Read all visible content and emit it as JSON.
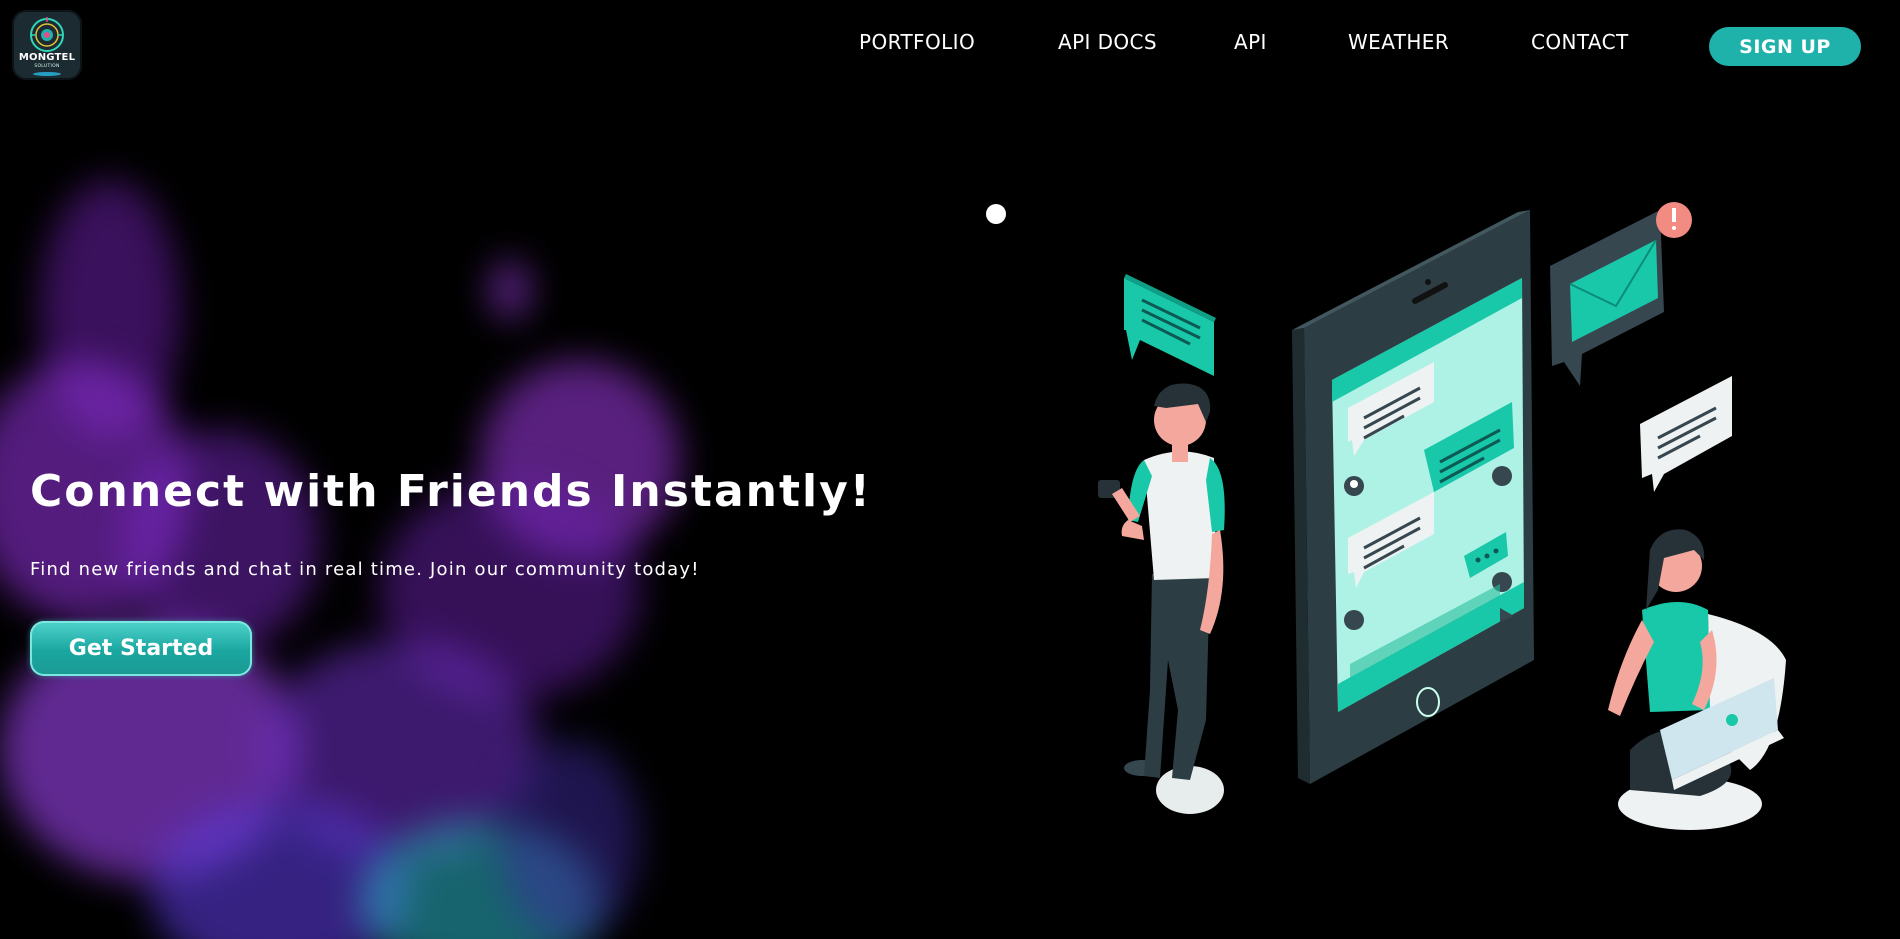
{
  "brand": {
    "name": "MONGTEL",
    "tagline": "SOLUTION"
  },
  "nav": {
    "items": [
      {
        "label": "PORTFOLIO"
      },
      {
        "label": "API DOCS"
      },
      {
        "label": "API"
      },
      {
        "label": "WEATHER"
      },
      {
        "label": "CONTACT"
      }
    ],
    "signup_label": "SIGN UP"
  },
  "hero": {
    "title": "Connect with Friends Instantly!",
    "subtitle": "Find new friends and chat in real time. Join our community today!",
    "cta_label": "Get Started"
  },
  "colors": {
    "accent": "#1fb2ab",
    "background": "#000000",
    "smoke_purple": "#9b3de0",
    "smoke_teal": "#2bb6c8"
  }
}
